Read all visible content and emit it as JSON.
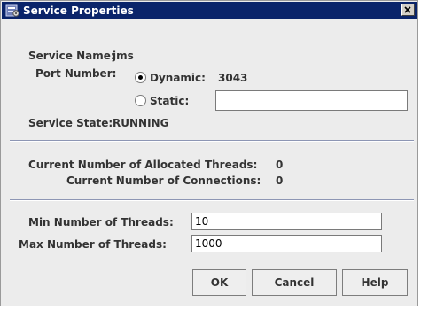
{
  "window": {
    "title": "Service Properties",
    "close_glyph": "✕"
  },
  "service": {
    "name_label": "Service Name:",
    "name_value": "jms",
    "port_label": "Port Number:",
    "dynamic_label": "Dynamic:",
    "dynamic_value": "3043",
    "static_label": "Static:",
    "static_value": "",
    "port_mode": "dynamic",
    "state_label": "Service State:",
    "state_value": "RUNNING"
  },
  "threads": {
    "allocated_label": "Current Number of Allocated Threads:",
    "allocated_value": "0",
    "connections_label": "Current Number of Connections:",
    "connections_value": "0"
  },
  "limits": {
    "min_label": "Min Number of Threads:",
    "min_value": "10",
    "max_label": "Max Number of Threads:",
    "max_value": "1000"
  },
  "buttons": {
    "ok": "OK",
    "cancel": "Cancel",
    "help": "Help"
  },
  "colors": {
    "titlebar": "#0a246a",
    "dialog_bg": "#ececec",
    "separator": "#8d96b4"
  },
  "icons": {
    "app": "service-properties-icon",
    "close": "close-icon"
  }
}
